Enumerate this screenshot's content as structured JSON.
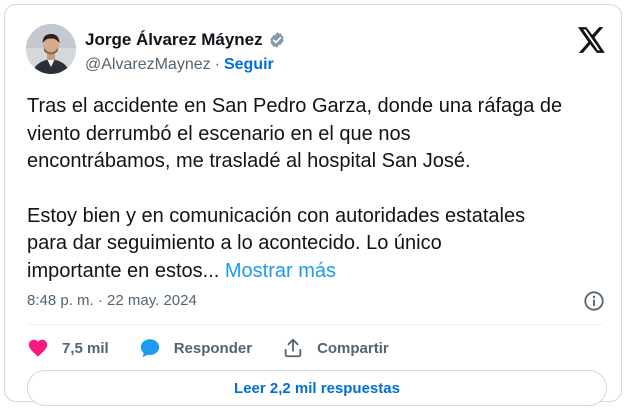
{
  "author": {
    "name": "Jorge Álvarez Máynez",
    "handle": "@AlvarezMaynez",
    "separator": "·",
    "follow_label": "Seguir"
  },
  "tweet": {
    "paragraphs": [
      [
        "Tras el accidente en San Pedro Garza, donde una ráfaga de",
        "viento derrumbó el escenario en el que nos",
        "encontrábamos, me trasladé al hospital San José."
      ],
      [
        "Estoy bien y en comunicación con autoridades estatales",
        "para dar seguimiento a lo acontecido. Lo único",
        "importante en estos..."
      ]
    ],
    "show_more_label": "Mostrar más",
    "timestamp": "8:48 p. m. · 22 may. 2024"
  },
  "actions": {
    "like_count": "7,5 mil",
    "reply_label": "Responder",
    "share_label": "Compartir"
  },
  "replies_button_label": "Leer 2,2 mil respuestas",
  "icons": {
    "verified": "verified-badge-icon",
    "platform": "x-logo-icon",
    "info": "info-icon",
    "like": "heart-icon",
    "reply": "speech-bubble-icon",
    "share": "share-upload-icon"
  },
  "colors": {
    "link_blue": "#1d9bf0",
    "follow_blue": "#006fd6",
    "like_pink": "#f91880",
    "text_primary": "#0f1419",
    "text_secondary": "#536471",
    "border": "#cfd9de"
  }
}
